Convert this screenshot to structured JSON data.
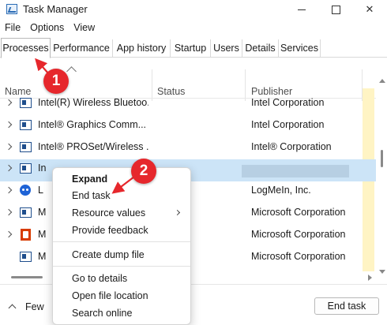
{
  "window": {
    "title": "Task Manager",
    "app_icon": "task-manager-icon"
  },
  "window_controls": {
    "minimize": "minimize-icon",
    "maximize": "maximize-icon",
    "close_glyph": "✕"
  },
  "menubar": {
    "items": [
      "File",
      "Options",
      "View"
    ]
  },
  "tabs": [
    "Processes",
    "Performance",
    "App history",
    "Startup",
    "Users",
    "Details",
    "Services"
  ],
  "active_tab": "Processes",
  "columns": {
    "name": "Name",
    "status": "Status",
    "publisher": "Publisher"
  },
  "rows": [
    {
      "name": "Intel(R) Wireless Bluetoo...",
      "publisher": "Intel Corporation",
      "icon": "service-icon"
    },
    {
      "name": "Intel® Graphics Comm...",
      "publisher": "Intel Corporation",
      "icon": "service-icon"
    },
    {
      "name": "Intel® PROSet/Wireless ...",
      "publisher": "Intel® Corporation",
      "icon": "service-icon"
    },
    {
      "name": "In",
      "publisher": "",
      "icon": "service-icon",
      "selected": true
    },
    {
      "name": "L",
      "publisher": "LogMeIn, Inc.",
      "icon": "logmein-icon"
    },
    {
      "name": "M",
      "publisher": "Microsoft Corporation",
      "icon": "service-icon"
    },
    {
      "name": "M",
      "publisher": "Microsoft Corporation",
      "icon": "office-icon"
    },
    {
      "name": "M",
      "publisher": "Microsoft Corporation",
      "icon": "service-icon"
    }
  ],
  "context_menu": {
    "items": [
      "Expand",
      "End task",
      "Resource values",
      "Provide feedback",
      "Create dump file",
      "Go to details",
      "Open file location",
      "Search online"
    ],
    "default_item": "Expand",
    "submenu_item": "Resource values"
  },
  "footer": {
    "fewer_details": "Few",
    "end_task_button": "End task"
  },
  "annotations": {
    "badge_1": "1",
    "badge_2": "2"
  },
  "colors": {
    "selection": "#cce4f7",
    "badge": "#e6272c",
    "cpu_heat": "#fff4c4"
  }
}
